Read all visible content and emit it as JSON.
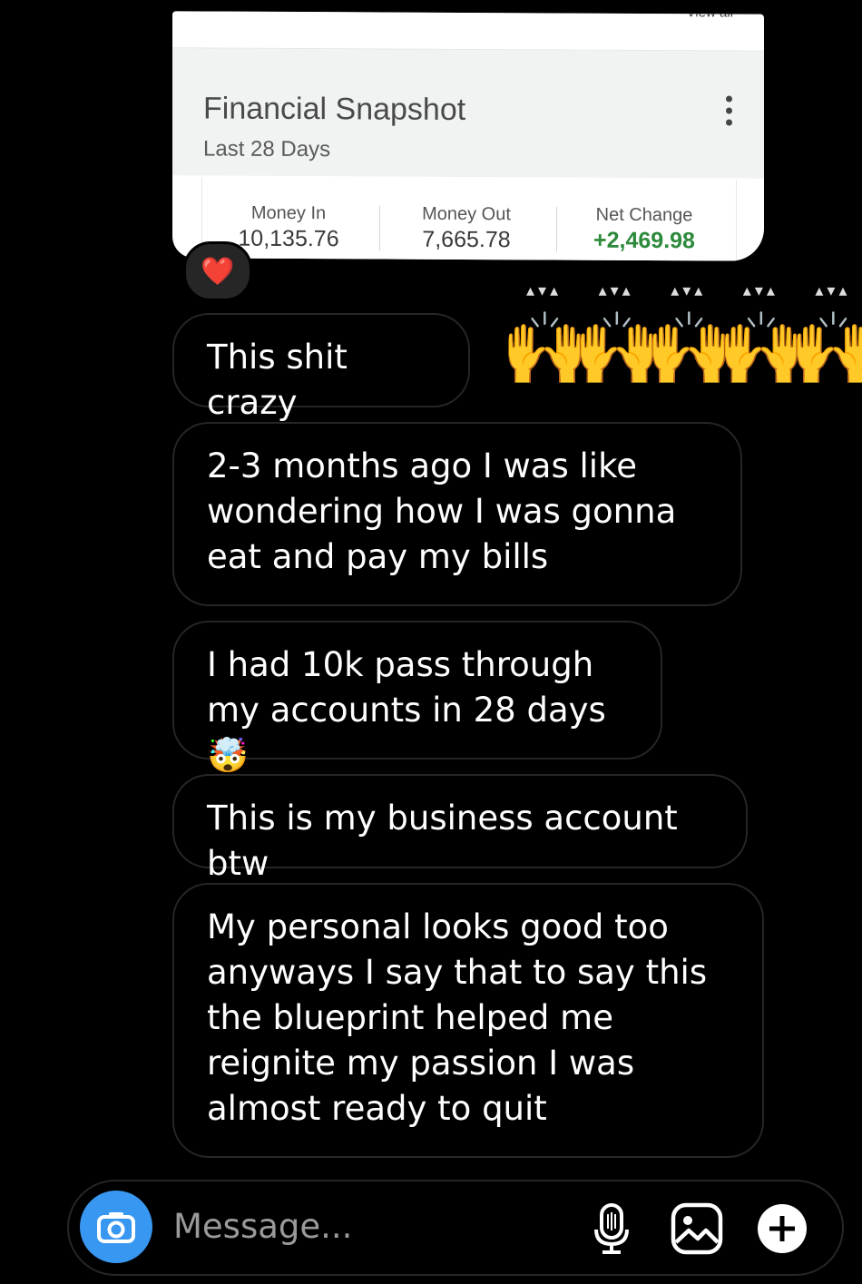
{
  "snapshot": {
    "view_all": "View all",
    "title": "Financial Snapshot",
    "subtitle": "Last 28 Days",
    "money_in_label": "Money In",
    "money_in_value": "10,135.76",
    "money_out_label": "Money Out",
    "money_out_value": "7,665.78",
    "net_change_label": "Net Change",
    "net_change_value": "+2,469.98"
  },
  "reaction": "❤️",
  "messages": {
    "m1": "This shit crazy",
    "m2": "2-3 months ago I was like wondering how I was gonna eat and pay my bills",
    "m3": "I had 10k pass through my accounts in 28 days 🤯",
    "m4": "This is my business account btw",
    "m5": "My personal looks good too anyways I say that to say this the blueprint helped me reignite my passion I was almost ready to quit"
  },
  "hands_emoji": "🙌",
  "composer": {
    "placeholder": "Message...",
    "camera_icon": "camera-icon",
    "mic_icon": "microphone-icon",
    "gallery_icon": "gallery-icon",
    "add_icon": "plus-icon"
  },
  "colors": {
    "accent": "#3897f0",
    "net_change_positive": "#2c8a3c",
    "bubble_border": "#262626",
    "heart": "#e0202c"
  }
}
